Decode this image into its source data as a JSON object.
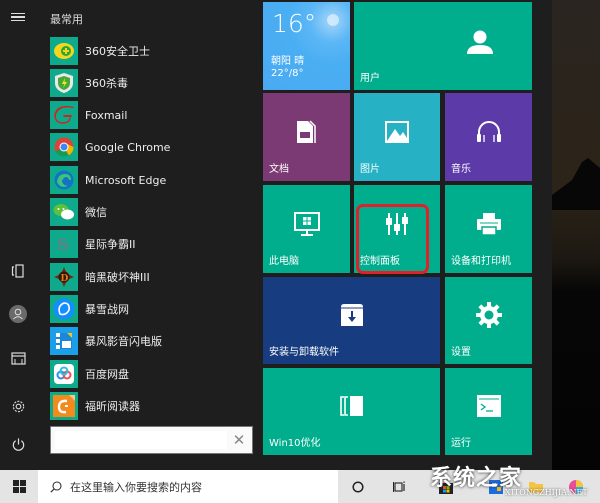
{
  "start_menu": {
    "section_title": "最常用",
    "apps": [
      {
        "label": "360安全卫士",
        "icon": "360-safe-icon"
      },
      {
        "label": "360杀毒",
        "icon": "360-antivirus-icon"
      },
      {
        "label": "Foxmail",
        "icon": "foxmail-icon"
      },
      {
        "label": "Google Chrome",
        "icon": "chrome-icon"
      },
      {
        "label": "Microsoft Edge",
        "icon": "edge-icon"
      },
      {
        "label": "微信",
        "icon": "wechat-icon"
      },
      {
        "label": "星际争霸II",
        "icon": "starcraft-icon"
      },
      {
        "label": "暗黑破坏神III",
        "icon": "diablo-icon"
      },
      {
        "label": "暴雪战网",
        "icon": "battlenet-icon"
      },
      {
        "label": "暴风影音闪电版",
        "icon": "baofeng-icon"
      },
      {
        "label": "百度网盘",
        "icon": "baidu-netdisk-icon"
      },
      {
        "label": "福昕阅读器",
        "icon": "foxit-reader-icon"
      }
    ],
    "search": {
      "value": "",
      "placeholder": ""
    },
    "rail": [
      "menu",
      "tablet-mode",
      "user",
      "documents",
      "settings",
      "power"
    ]
  },
  "tiles": {
    "weather": {
      "temp": "16°",
      "city_condition": "朝阳  晴",
      "range": "22°/8°"
    },
    "user": {
      "label": "用户"
    },
    "documents": {
      "label": "文档"
    },
    "pictures": {
      "label": "图片"
    },
    "music": {
      "label": "音乐"
    },
    "this_pc": {
      "label": "此电脑"
    },
    "control_panel": {
      "label": "控制面板",
      "highlighted": true
    },
    "devices_printers": {
      "label": "设备和打印机"
    },
    "uninstall": {
      "label": "安装与卸载软件"
    },
    "settings": {
      "label": "设置"
    },
    "win10_optimize": {
      "label": "Win10优化"
    },
    "run": {
      "label": "运行"
    }
  },
  "colors": {
    "tile_green": "#00ae8e",
    "tile_purple": "#7b3a73",
    "tile_cyan": "#26b1c4",
    "tile_violet": "#5c3ba9",
    "tile_blue": "#173d80",
    "weather_blue": "#4aaaf1",
    "highlight_red": "#e0212c"
  },
  "taskbar": {
    "search_placeholder": "在这里输入你要搜索的内容"
  },
  "watermark": {
    "title": "系统之家",
    "subtitle": "XITONGZHIJIA.NET"
  }
}
